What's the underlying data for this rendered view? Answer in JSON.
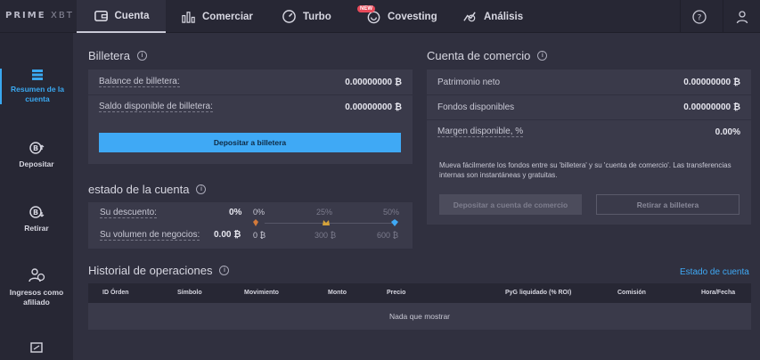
{
  "logo": {
    "brand": "PRIME",
    "suffix": "XBT"
  },
  "nav": {
    "cuenta": "Cuenta",
    "comerciar": "Comerciar",
    "turbo": "Turbo",
    "covesting": "Covesting",
    "covesting_badge": "NEW",
    "analisis": "Análisis"
  },
  "sidebar": {
    "resumen": "Resumen de la cuenta",
    "depositar": "Depositar",
    "retirar": "Retirar",
    "ingresos": "Ingresos como afiliado"
  },
  "billetera": {
    "title": "Billetera",
    "balance_label": "Balance de billetera:",
    "balance_value": "0.00000000 ₿",
    "saldo_label": "Saldo disponible de billetera:",
    "saldo_value": "0.00000000 ₿",
    "deposit_button": "Depositar a billetera"
  },
  "cuenta_comercio": {
    "title": "Cuenta de comercio",
    "patrimonio_label": "Patrimonio neto",
    "patrimonio_value": "0.00000000 ₿",
    "fondos_label": "Fondos disponibles",
    "fondos_value": "0.00000000 ₿",
    "margen_label": "Margen disponible, %",
    "margen_value": "0.00%",
    "description": "Mueva fácilmente los fondos entre su 'billetera' y su 'cuenta de comercio'. Las transferencias internas son instantáneas y gratuitas.",
    "depositar_button": "Depositar a cuenta de comercio",
    "retirar_button": "Retirar a billetera"
  },
  "estado": {
    "title": "estado de la cuenta",
    "descuento_label": "Su descuento:",
    "descuento_value": "0%",
    "volumen_label": "Su volumen de negocios:",
    "volumen_value": "0.00 ₿",
    "tiers": {
      "t1_pct": "0%",
      "t1_vol": "0 ₿",
      "t2_pct": "25%",
      "t2_vol": "300 ₿",
      "t3_pct": "50%",
      "t3_vol": "600 ₿"
    }
  },
  "historial": {
    "title": "Historial de operaciones",
    "link": "Estado de cuenta",
    "columns": {
      "id": "ID Órden",
      "simbolo": "Símbolo",
      "movimiento": "Movimiento",
      "monto": "Monto",
      "precio": "Precio",
      "pyg": "PyG liquidado (% ROI)",
      "comision": "Comisión",
      "fecha": "Hora/Fecha"
    },
    "empty": "Nada que mostrar"
  },
  "colors": {
    "accent": "#3fa9f5",
    "bg": "#30303f",
    "panel": "#3a3a4a",
    "bar": "#272734"
  }
}
